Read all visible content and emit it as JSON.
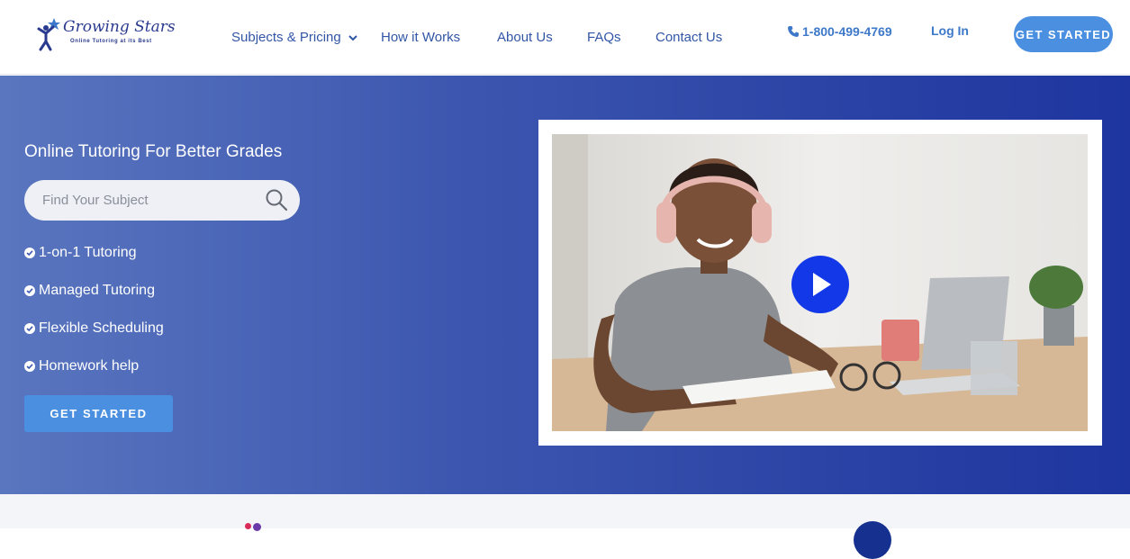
{
  "header": {
    "logo": {
      "title": "Growing Stars",
      "tagline": "Online Tutoring at its Best"
    },
    "nav": [
      {
        "label": "Subjects & Pricing",
        "has_dropdown": true
      },
      {
        "label": "How it Works"
      },
      {
        "label": "About Us"
      },
      {
        "label": "FAQs"
      },
      {
        "label": "Contact Us"
      }
    ],
    "phone": "1-800-499-4769",
    "login": "Log In",
    "cta": "GET STARTED"
  },
  "hero": {
    "title": "Online Tutoring For Better Grades",
    "search": {
      "placeholder": "Find Your Subject",
      "value": ""
    },
    "features": [
      "1-on-1 Tutoring",
      "Managed Tutoring",
      "Flexible Scheduling",
      "Homework help"
    ],
    "cta": "GET STARTED",
    "video": {
      "icon": "play-icon"
    }
  },
  "colors": {
    "accent": "#4a8fe0",
    "nav_text": "#3256a6",
    "hero_gradient_start": "#5a76bf",
    "hero_gradient_end": "#1e35a0",
    "play_button": "#1238e8"
  }
}
